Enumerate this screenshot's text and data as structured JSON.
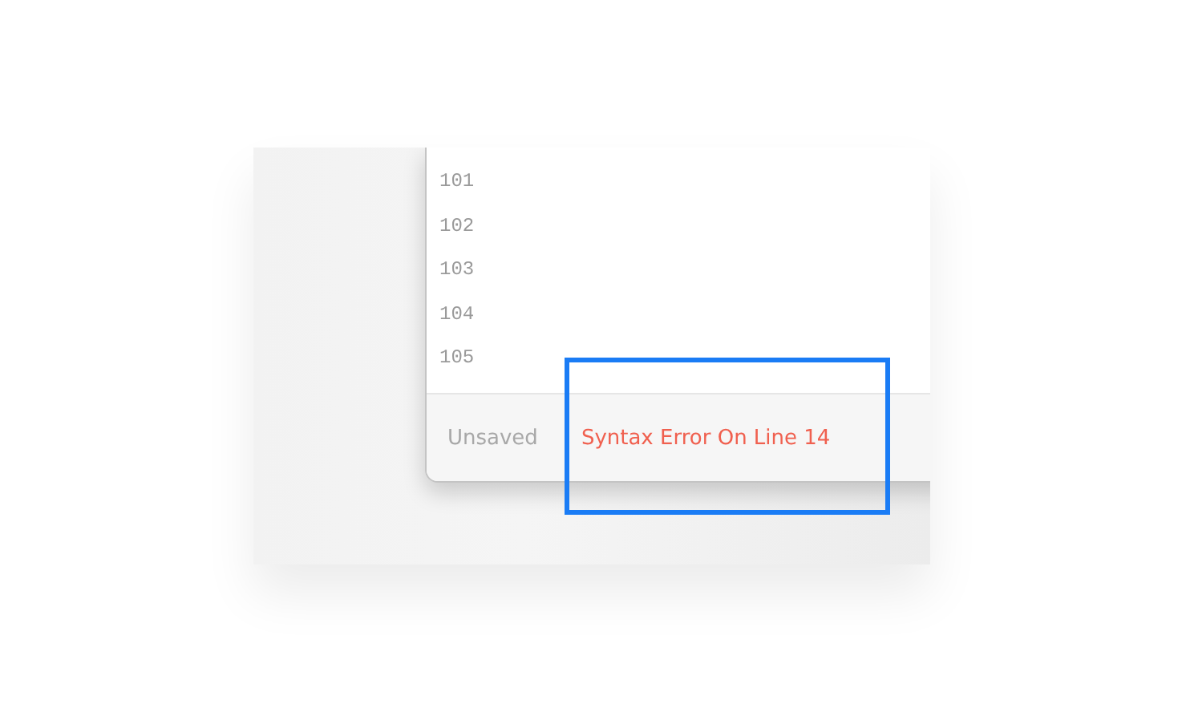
{
  "editor": {
    "line_numbers": [
      "101",
      "102",
      "103",
      "104",
      "105"
    ]
  },
  "status_bar": {
    "save_state": "Unsaved",
    "error": "Syntax Error On Line 14"
  }
}
